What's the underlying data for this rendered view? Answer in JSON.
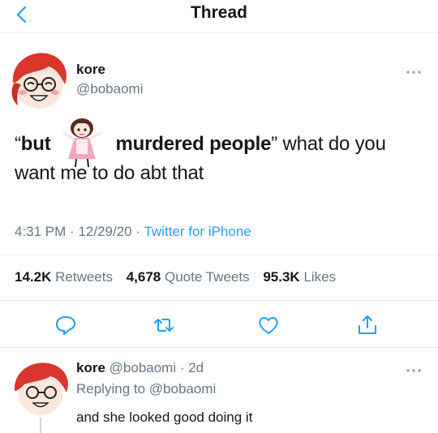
{
  "header": {
    "title": "Thread"
  },
  "tweet": {
    "name": "kore",
    "handle": "@bobaomi",
    "text_quote_open": "“",
    "text_bold_1": "but",
    "text_bold_2": "murdered people",
    "text_rest": "” what do you want me to do abt that",
    "time": "4:31 PM",
    "date": "12/29/20",
    "source": "Twitter for iPhone",
    "sep": "·",
    "stats": {
      "retweets_count": "14.2K",
      "retweets_label": "Retweets",
      "quotes_count": "4,678",
      "quotes_label": "Quote Tweets",
      "likes_count": "95.3K",
      "likes_label": "Likes"
    }
  },
  "reply": {
    "name": "kore",
    "handle_time": "@bobaomi · 2d",
    "replying_to": "Replying to @bobaomi",
    "text": "and she looked good doing it"
  },
  "icons": {
    "back": "chevron-left-icon",
    "more": "more-dots-icon",
    "reply": "comment-icon",
    "retweet": "retweet-icon",
    "like": "heart-icon",
    "share": "share-icon"
  },
  "colors": {
    "accent": "#1da1f2",
    "secondary_text": "#657786",
    "primary_text": "#14171a",
    "divider": "#e6ecf0"
  }
}
